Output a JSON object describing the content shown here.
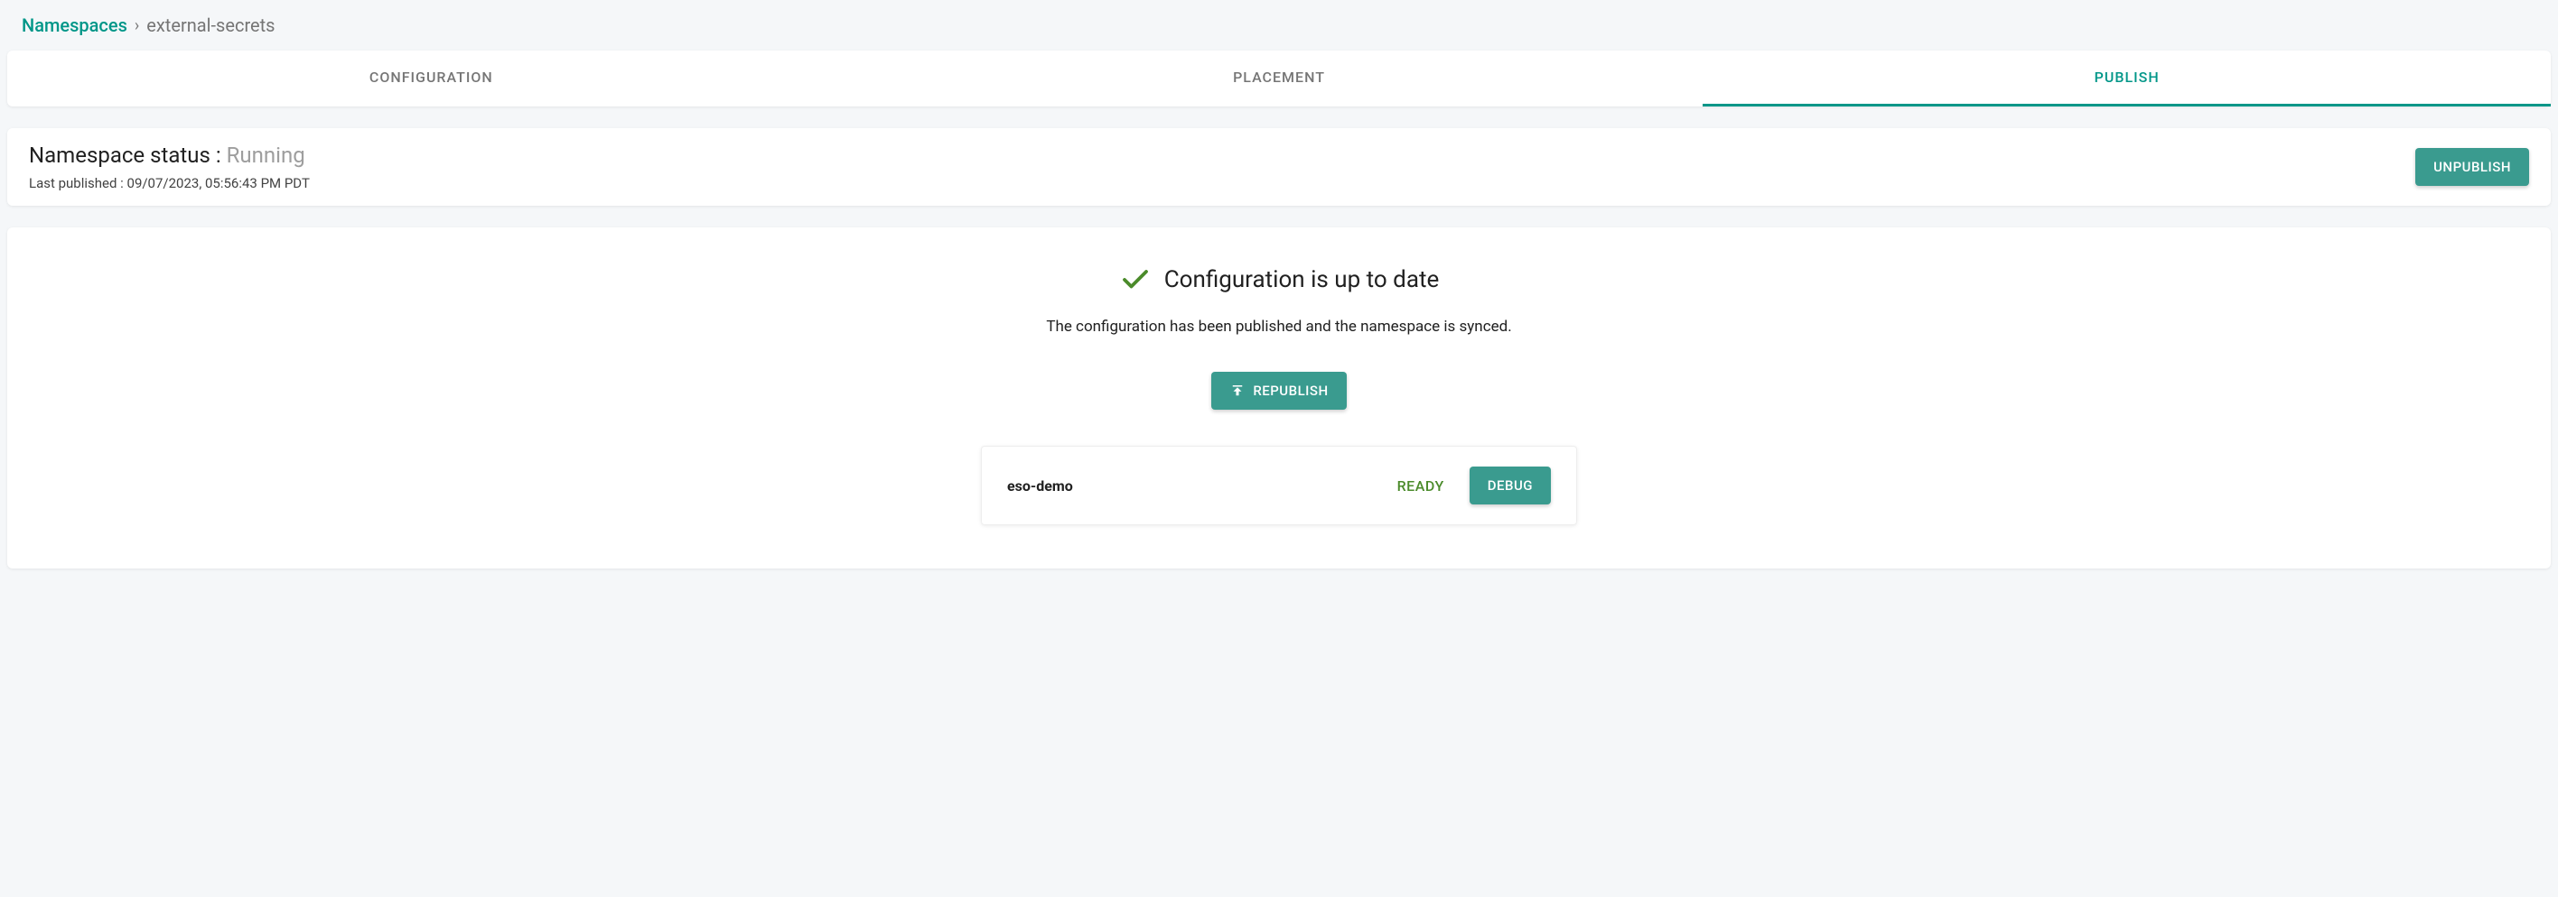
{
  "breadcrumb": {
    "root": "Namespaces",
    "separator": "›",
    "current": "external-secrets"
  },
  "tabs": {
    "configuration": "CONFIGURATION",
    "placement": "PLACEMENT",
    "publish": "PUBLISH"
  },
  "status": {
    "label": "Namespace status : ",
    "value": "Running",
    "lastPublished": "Last published : 09/07/2023, 05:56:43 PM PDT",
    "unpublishBtn": "UNPUBLISH"
  },
  "main": {
    "heading": "Configuration is up to date",
    "subtext": "The configuration has been published and the namespace is synced.",
    "republishBtn": "REPUBLISH"
  },
  "item": {
    "name": "eso-demo",
    "status": "READY",
    "debugBtn": "DEBUG"
  }
}
